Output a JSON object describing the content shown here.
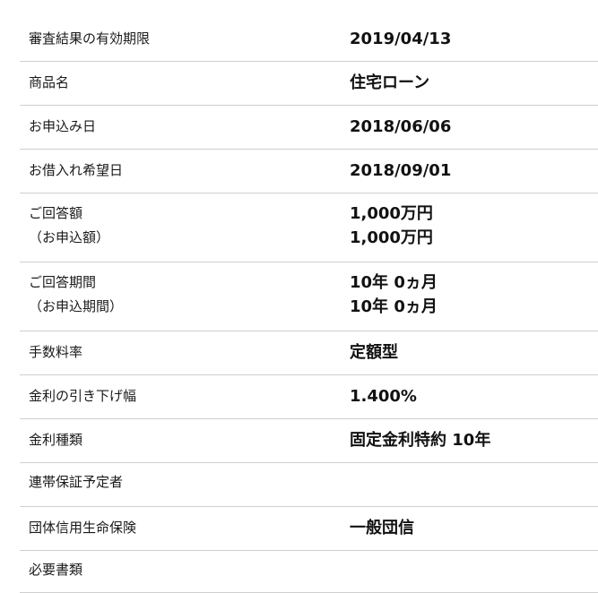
{
  "rows": [
    {
      "label": [
        "審査結果の有効期限"
      ],
      "value": [
        "2019/04/13"
      ]
    },
    {
      "label": [
        "商品名"
      ],
      "value": [
        "住宅ローン"
      ]
    },
    {
      "label": [
        "お申込み日"
      ],
      "value": [
        "2018/06/06"
      ]
    },
    {
      "label": [
        "お借入れ希望日"
      ],
      "value": [
        "2018/09/01"
      ]
    },
    {
      "label": [
        "ご回答額",
        "（お申込額）"
      ],
      "value": [
        "1,000万円",
        "1,000万円"
      ]
    },
    {
      "label": [
        "ご回答期間",
        "（お申込期間）"
      ],
      "value": [
        "10年 0ヵ月",
        "10年 0ヵ月"
      ]
    },
    {
      "label": [
        "手数料率"
      ],
      "value": [
        "定額型"
      ]
    },
    {
      "label": [
        "金利の引き下げ幅"
      ],
      "value": [
        "1.400%"
      ]
    },
    {
      "label": [
        "金利種類"
      ],
      "value": [
        "固定金利特約 10年"
      ]
    },
    {
      "label": [
        "連帯保証予定者"
      ],
      "value": []
    },
    {
      "label": [
        "団体信用生命保険"
      ],
      "value": [
        "一般団信"
      ]
    },
    {
      "label": [
        "必要書類"
      ],
      "value": []
    }
  ]
}
